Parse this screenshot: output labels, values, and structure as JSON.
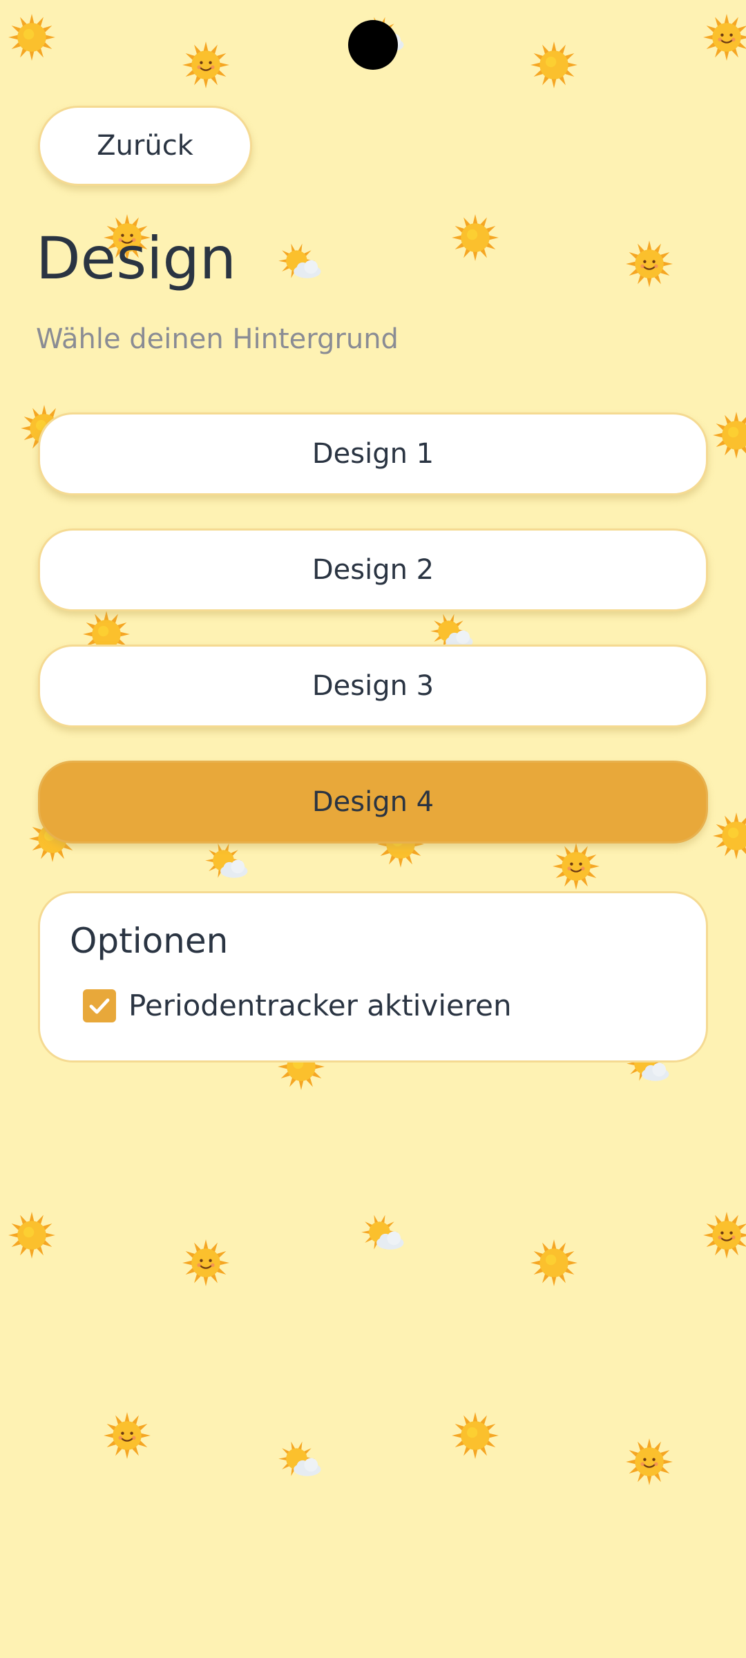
{
  "header": {
    "back_label": "Zurück"
  },
  "page": {
    "title": "Design",
    "subtitle": "Wähle deinen Hintergrund"
  },
  "designs": {
    "items": [
      {
        "label": "Design 1",
        "selected": false
      },
      {
        "label": "Design 2",
        "selected": false
      },
      {
        "label": "Design 3",
        "selected": false
      },
      {
        "label": "Design 4",
        "selected": true
      }
    ]
  },
  "options": {
    "title": "Optionen",
    "period_tracker": {
      "label": "Periodentracker aktivieren",
      "checked": true
    }
  },
  "icons": {
    "background": [
      "sun-icon",
      "smiling-sun-icon",
      "sun-behind-cloud-icon"
    ],
    "checkbox": "checkmark-icon"
  },
  "colors": {
    "background": "#fef2b3",
    "card": "#ffffff",
    "card_border": "#f5da92",
    "accent": "#e8a83a",
    "text": "#2a3442",
    "subtitle": "#8a8c94"
  }
}
